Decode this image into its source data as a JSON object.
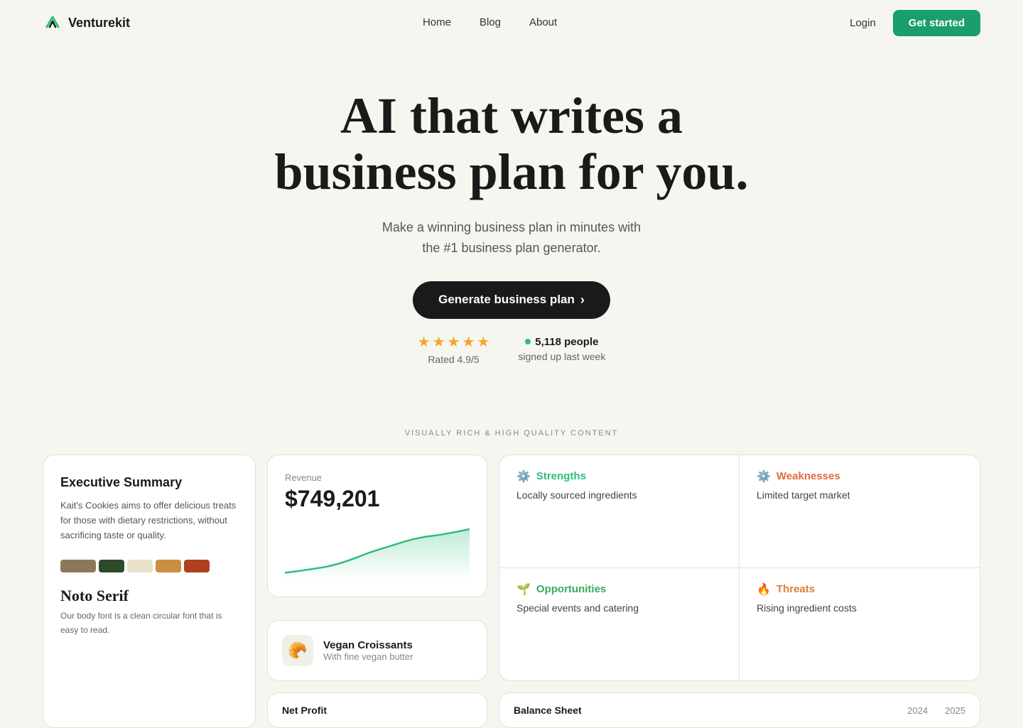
{
  "nav": {
    "brand": "Venturekit",
    "links": [
      "Home",
      "Blog",
      "About"
    ],
    "login": "Login",
    "cta": "Get started"
  },
  "hero": {
    "headline_line1": "AI that writes a",
    "headline_line2": "business plan for you.",
    "subtext_line1": "Make a winning business plan in minutes with",
    "subtext_line2": "the #1 business plan generator.",
    "cta_button": "Generate business plan",
    "cta_arrow": "›"
  },
  "social_proof": {
    "stars": [
      "★",
      "★",
      "★",
      "★",
      "★"
    ],
    "rating": "Rated 4.9/5",
    "signups": "5,118 people",
    "signup_sub": "signed up last week"
  },
  "section_label": "VISUALLY RICH & HIGH QUALITY CONTENT",
  "executive_card": {
    "title": "Executive Summary",
    "body": "Kait's Cookies aims to offer delicious treats for those with dietary restrictions, without sacrificing taste or quality.",
    "font_name": "Noto Serif",
    "font_desc": "Our body font is a clean circular font that is easy to read.",
    "colors": [
      "#8a7a5a",
      "#2d4a2d",
      "#e8e0c8",
      "#c89040",
      "#b04020"
    ]
  },
  "revenue_card": {
    "label": "Revenue",
    "value": "$749,201"
  },
  "product_card": {
    "name": "Vegan Croissants",
    "sub": "With fine vegan butter"
  },
  "swot": {
    "strengths_title": "Strengths",
    "strengths_text": "Locally sourced ingredients",
    "weaknesses_title": "Weaknesses",
    "weaknesses_text": "Limited target market",
    "opportunities_title": "Opportunities",
    "opportunities_text": "Special events and catering",
    "threats_title": "Threats",
    "threats_text": "Rising ingredient costs"
  },
  "bottom": {
    "net_profit": "Net Profit",
    "balance_sheet": "Balance Sheet",
    "year1": "2024",
    "year2": "2025"
  }
}
